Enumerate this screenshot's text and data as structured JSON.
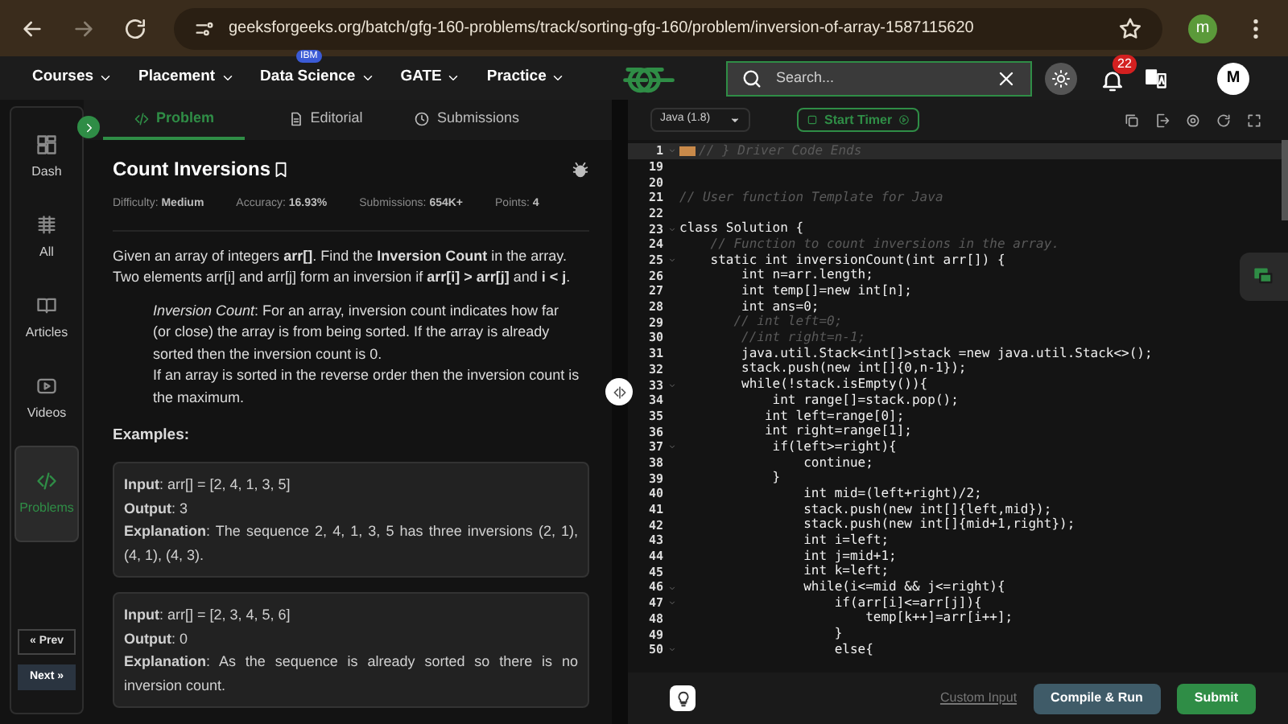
{
  "browser": {
    "url": "geeksforgeeks.org/batch/gfg-160-problems/track/sorting-gfg-160/problem/inversion-of-array-1587115620",
    "profile": "m"
  },
  "nav": {
    "items": [
      {
        "label": "Courses"
      },
      {
        "label": "Placement"
      },
      {
        "label": "Data Science",
        "badge": "IBM"
      },
      {
        "label": "GATE"
      },
      {
        "label": "Practice"
      }
    ],
    "search": {
      "placeholder": "Search..."
    },
    "notifications": "22",
    "avatar": "M"
  },
  "sidebar": {
    "items": [
      {
        "label": "Dash",
        "selected": false
      },
      {
        "label": "All",
        "selected": false
      },
      {
        "label": "Articles",
        "selected": false
      },
      {
        "label": "Videos",
        "selected": false
      },
      {
        "label": "Problems",
        "selected": true
      }
    ],
    "prev": "« Prev",
    "next": "Next »"
  },
  "tabs": [
    {
      "label": "Problem",
      "selected": true
    },
    {
      "label": "Editorial",
      "selected": false
    },
    {
      "label": "Submissions",
      "selected": false
    }
  ],
  "problem": {
    "title": "Count Inversions",
    "stats": [
      {
        "label": "Difficulty:",
        "value": "Medium"
      },
      {
        "label": "Accuracy:",
        "value": "16.93%"
      },
      {
        "label": "Submissions:",
        "value": "654K+"
      },
      {
        "label": "Points:",
        "value": "4"
      }
    ],
    "description": "Given an array of integers **arr[]**. Find the **Inversion Count** in the array. Two elements arr[i] and arr[j] form an inversion if **arr[i] > arr[j]** and **i < j**.",
    "note": [
      "*Inversion Count*: For an array, inversion count indicates how far (or close) the array is from being sorted. If the array is already sorted then the inversion count is 0.",
      "If an array is sorted in the reverse order then the inversion count is the maximum."
    ],
    "examples_heading": "Examples:",
    "examples": [
      [
        "**Input**: arr[] = [2, 4, 1, 3, 5]",
        "**Output**: 3",
        "**Explanation**: The sequence 2, 4, 1, 3, 5 has three inversions (2, 1), (4, 1), (4, 3)."
      ],
      [
        "**Input**: arr[] = [2, 3, 4, 5, 6]",
        "**Output**: 0",
        "**Explanation**: As the sequence is already sorted so there is no inversion count."
      ]
    ]
  },
  "editor": {
    "language": "Java (1.8)",
    "timer": "Start Timer",
    "lines": [
      {
        "n": "1",
        "kind": "folded",
        "fold": true,
        "text": "// } Driver Code Ends"
      },
      {
        "n": "19",
        "kind": "code",
        "fold": false
      },
      {
        "n": "20",
        "kind": "code",
        "fold": false
      },
      {
        "n": "21",
        "kind": "comment",
        "fold": false,
        "text": "// User function Template for Java"
      },
      {
        "n": "22",
        "kind": "code",
        "fold": false
      },
      {
        "n": "23",
        "kind": "code",
        "fold": true,
        "text": "class Solution {"
      },
      {
        "n": "24",
        "kind": "comment",
        "fold": false,
        "text": "    // Function to count inversions in the array."
      },
      {
        "n": "25",
        "kind": "code",
        "fold": true,
        "text": "    static int inversionCount(int arr[]) {"
      },
      {
        "n": "26",
        "kind": "code",
        "fold": false,
        "text": "        int n=arr.length;"
      },
      {
        "n": "27",
        "kind": "code",
        "fold": false,
        "text": "        int temp[]=new int[n];"
      },
      {
        "n": "28",
        "kind": "code",
        "fold": false,
        "text": "        int ans=0;"
      },
      {
        "n": "29",
        "kind": "comment",
        "fold": false,
        "text": "       // int left=0;"
      },
      {
        "n": "30",
        "kind": "comment",
        "fold": false,
        "text": "        //int right=n-1;"
      },
      {
        "n": "31",
        "kind": "code",
        "fold": false,
        "text": "        java.util.Stack<int[]>stack =new java.util.Stack<>();"
      },
      {
        "n": "32",
        "kind": "code",
        "fold": false,
        "text": "        stack.push(new int[]{0,n-1});"
      },
      {
        "n": "33",
        "kind": "code",
        "fold": true,
        "text": "        while(!stack.isEmpty()){"
      },
      {
        "n": "34",
        "kind": "code",
        "fold": false,
        "text": "            int range[]=stack.pop();"
      },
      {
        "n": "35",
        "kind": "code",
        "fold": false,
        "text": "           int left=range[0];"
      },
      {
        "n": "36",
        "kind": "code",
        "fold": false,
        "text": "           int right=range[1];"
      },
      {
        "n": "37",
        "kind": "code",
        "fold": true,
        "text": "            if(left>=right){"
      },
      {
        "n": "38",
        "kind": "code",
        "fold": false,
        "text": "                continue;"
      },
      {
        "n": "39",
        "kind": "code",
        "fold": false,
        "text": "            }"
      },
      {
        "n": "40",
        "kind": "code",
        "fold": false,
        "text": "                int mid=(left+right)/2;"
      },
      {
        "n": "41",
        "kind": "code",
        "fold": false,
        "text": "                stack.push(new int[]{left,mid});"
      },
      {
        "n": "42",
        "kind": "code",
        "fold": false,
        "text": "                stack.push(new int[]{mid+1,right});"
      },
      {
        "n": "43",
        "kind": "code",
        "fold": false,
        "text": "                int i=left;"
      },
      {
        "n": "44",
        "kind": "code",
        "fold": false,
        "text": "                int j=mid+1;"
      },
      {
        "n": "45",
        "kind": "code",
        "fold": false,
        "text": "                int k=left;"
      },
      {
        "n": "46",
        "kind": "code",
        "fold": true,
        "text": "                while(i<=mid && j<=right){"
      },
      {
        "n": "47",
        "kind": "code",
        "fold": true,
        "text": "                    if(arr[i]<=arr[j]){"
      },
      {
        "n": "48",
        "kind": "code",
        "fold": false,
        "text": "                        temp[k++]=arr[i++];"
      },
      {
        "n": "49",
        "kind": "code",
        "fold": false,
        "text": "                    }"
      },
      {
        "n": "50",
        "kind": "code",
        "fold": true,
        "text": "                    else{"
      }
    ]
  },
  "footer": {
    "custom_input": "Custom Input",
    "run": "Compile & Run",
    "submit": "Submit"
  }
}
